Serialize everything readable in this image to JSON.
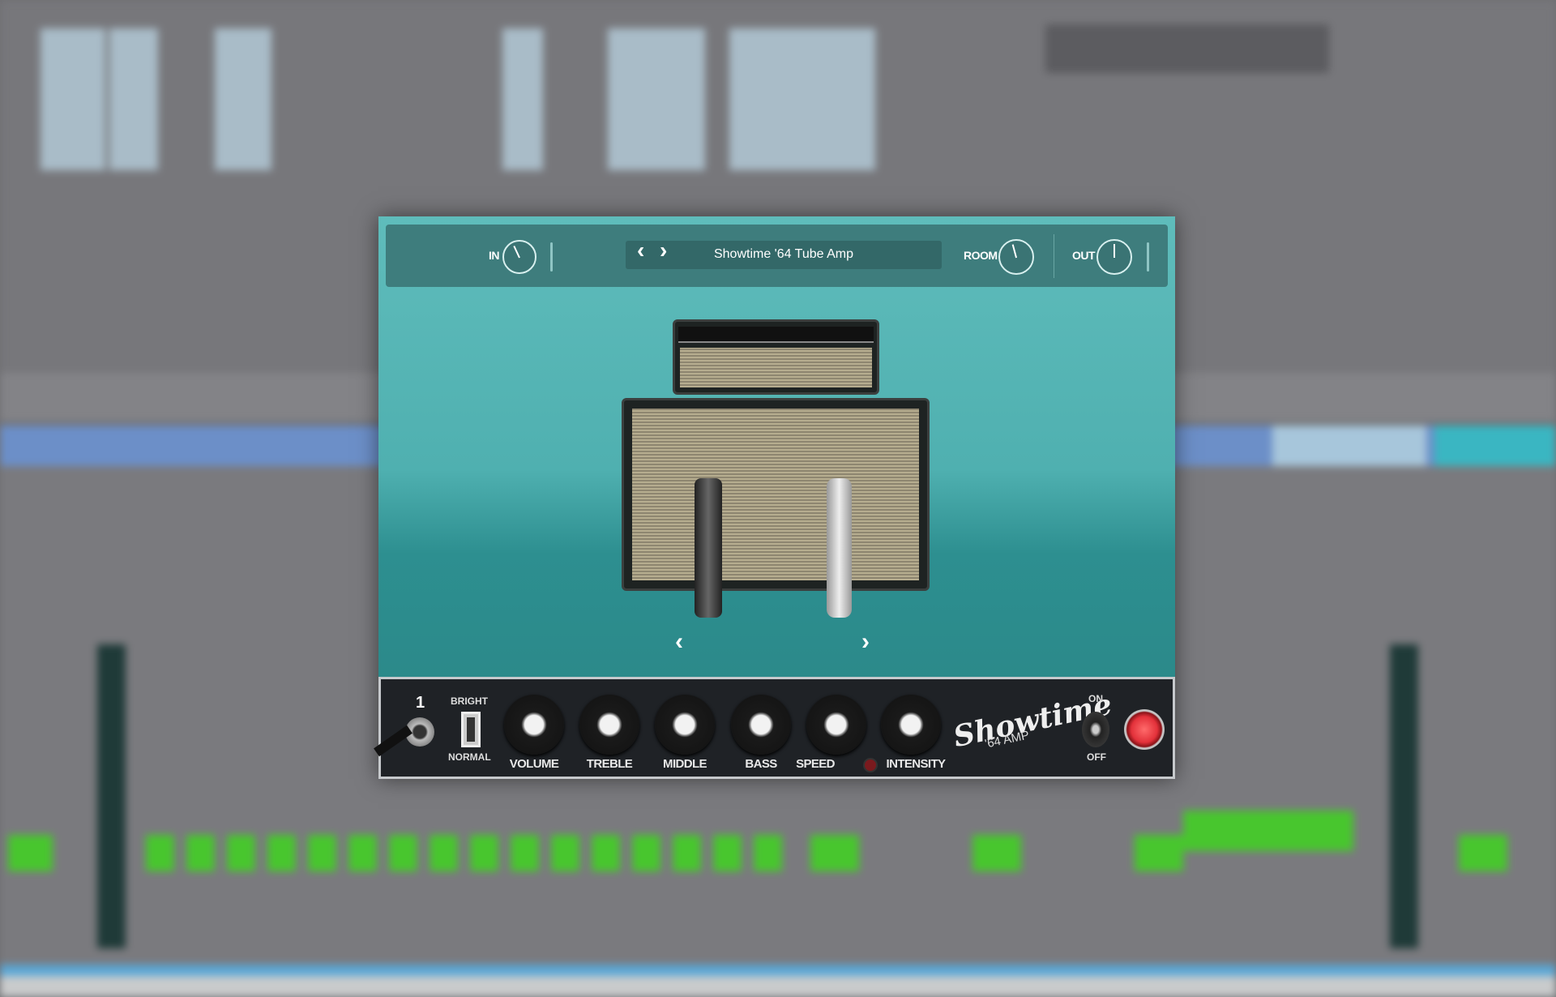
{
  "header": {
    "in_label": "IN",
    "preset_name": "Showtime '64 Tube Amp",
    "room_label": "ROOM",
    "out_label": "OUT",
    "prev_label": "‹",
    "next_label": "›"
  },
  "scene": {
    "prev_label": "‹",
    "next_label": "›"
  },
  "panel": {
    "channel": "1",
    "bright_label": "BRIGHT",
    "normal_label": "NORMAL",
    "knobs": [
      "VOLUME",
      "TREBLE",
      "MIDDLE",
      "BASS",
      "SPEED",
      "INTENSITY"
    ],
    "logo": "Showtime",
    "logo_sub": "'64 AMP",
    "on_label": "ON",
    "off_label": "OFF"
  },
  "colors": {
    "accent": "#4fb0b0",
    "panel": "#1f2226",
    "pilot": "#e3313a"
  }
}
